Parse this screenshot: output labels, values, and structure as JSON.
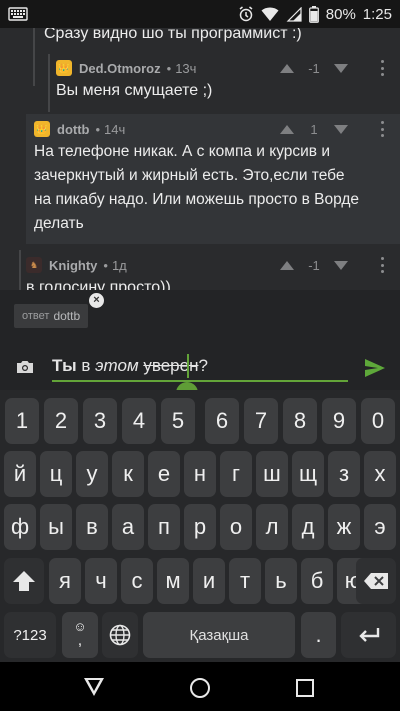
{
  "status_bar": {
    "battery_percent": "80%",
    "time": "1:25",
    "icons": [
      "keyboard-icon",
      "alarm-icon",
      "wifi-icon",
      "signal-icon",
      "battery-icon"
    ]
  },
  "comments": {
    "top_partial_text": "Сразу видно шо ты программист :)",
    "items": [
      {
        "author": "Ded.Otmoroz",
        "time": "13ч",
        "votes": "-1",
        "text": "Вы меня смущаете ;)"
      },
      {
        "author": "dottb",
        "time": "14ч",
        "votes": "1",
        "text_lines": [
          "На телефоне никак. А с компа и курсив и",
          "зачеркнутый и жирный есть. Это,если тебе",
          "на пикабу надо. Или можешь просто в Ворде",
          "делать"
        ]
      },
      {
        "author": "Knighty",
        "time": "1д",
        "votes": "-1",
        "text": "в голосину просто))"
      }
    ]
  },
  "reply": {
    "chip_prefix": "ответ",
    "chip_to": "dottb",
    "input_bold": "Ты",
    "input_plain_1": " в ",
    "input_italic": "этом",
    "input_plain_2": " ",
    "input_strike": "уверен",
    "input_tail": "?"
  },
  "keyboard": {
    "row1": [
      "1",
      "2",
      "3",
      "4",
      "5",
      "6",
      "7",
      "8",
      "9",
      "0"
    ],
    "row2": [
      "й",
      "ц",
      "у",
      "к",
      "е",
      "н",
      "г",
      "ш",
      "щ",
      "з",
      "х"
    ],
    "row3": [
      "ф",
      "ы",
      "в",
      "а",
      "п",
      "р",
      "о",
      "л",
      "д",
      "ж",
      "э"
    ],
    "row4": [
      "я",
      "ч",
      "с",
      "м",
      "и",
      "т",
      "ь",
      "б",
      "ю"
    ],
    "symbols": "?123",
    "emoji_comma": ",",
    "space": "Қазақша",
    "period": "."
  },
  "colors": {
    "accent": "#62a338",
    "avatar_gold": "#f0b52b"
  }
}
